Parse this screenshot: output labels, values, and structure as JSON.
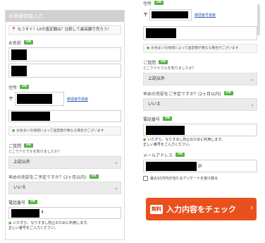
{
  "left": {
    "header": "お客様情報入力",
    "info": "もうすぐ！LXの査定額は？比較して最高額で売ろう！",
    "name_label": "お名前",
    "name_badge": "OK",
    "address_label": "住所",
    "address_badge": "OK",
    "zip_mark": "〒",
    "zip_link": "郵便番号検索",
    "notice": "お住まいの地域によって査定額が異なる場合がございます",
    "q1_label": "ご質問",
    "q1_badge": "OK",
    "q1_sub": "どこでナビクルを知りましたか？",
    "q1_value": "上記以外",
    "q2_label": "早めの売却をご予定ですか？(2ヶ月以内)",
    "q2_badge": "OK",
    "q2_value": "いいえ",
    "phone_label": "電話番号",
    "phone_badge": "OK",
    "phone_suffix": "4",
    "phone_hint1": "いたずら、なりすまし防止のために利用します。",
    "phone_hint2": "正しい番号をご入力ください。"
  },
  "right": {
    "address_label": "住所",
    "address_badge": "OK",
    "zip_mark": "〒",
    "zip_link": "郵便番号検索",
    "notice": "お住まいの地域によって査定額が異なる場合がございます",
    "q1_label": "ご質問",
    "q1_badge": "OK",
    "q1_sub": "どこでナビクルを知りましたか？",
    "q1_value": "上記以外",
    "q2_label": "早めの売却をご予定ですか？(2ヶ月以内)",
    "q2_badge": "OK",
    "q2_value": "いいえ",
    "phone_label": "電話番号",
    "phone_badge": "OK",
    "phone_hint1": "いたずら、なりすまし防止のために利用します。",
    "phone_hint2": "正しい番号をご入力ください。",
    "email_label": "メールアドレス",
    "email_badge": "OK",
    "email_suffix": "jp",
    "checkbox_label": "最大10万円が当たるアンケートを受け取る",
    "cta_tag": "無料",
    "cta_text": "入力内容をチェック",
    "cta_arrow": "›"
  },
  "colors": {
    "accent_green": "#57b346",
    "cta_orange": "#e9501e",
    "link_blue": "#2f5fb5"
  },
  "icons": {
    "pin": "map-pin-icon",
    "caret": "chevron-down-icon",
    "notice": "info-icon"
  }
}
